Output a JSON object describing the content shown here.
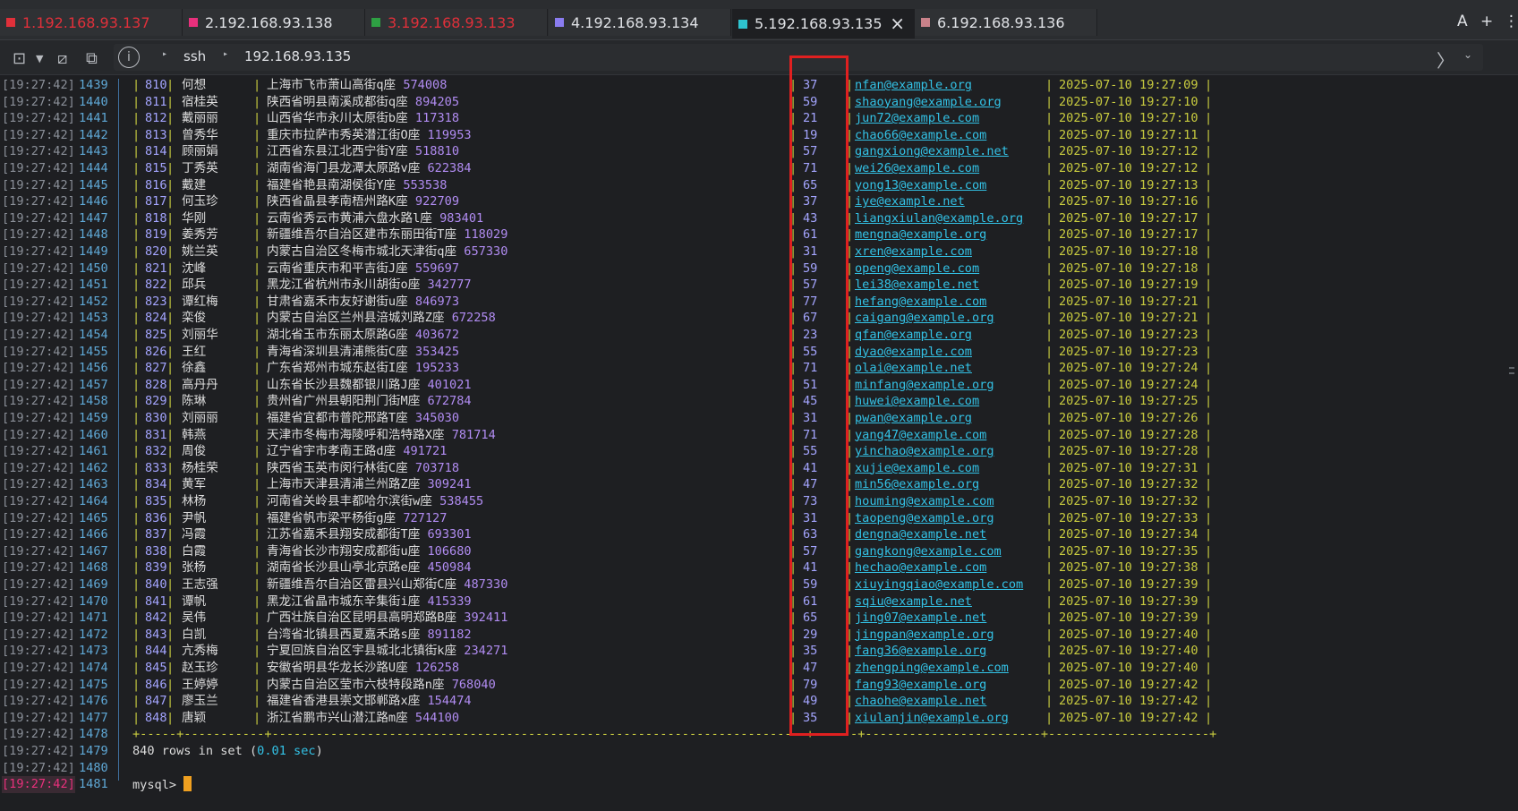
{
  "tabs": [
    {
      "label": "1.192.168.93.137",
      "color": "#e0303a",
      "text_color": "#e0303a"
    },
    {
      "label": "2.192.168.93.138",
      "color": "#e8307c",
      "text_color": "#dfe1e5"
    },
    {
      "label": "3.192.168.93.133",
      "color": "#2ea043",
      "text_color": "#e0303a"
    },
    {
      "label": "4.192.168.93.134",
      "color": "#8a7cf0",
      "text_color": "#dfe1e5"
    },
    {
      "label": "5.192.168.93.135",
      "color": "#2ec4d0",
      "text_color": "#dfe1e5",
      "active": true
    },
    {
      "label": "6.192.168.93.136",
      "color": "#c9828a",
      "text_color": "#dfe1e5"
    }
  ],
  "window_controls": {
    "font": "A",
    "add": "+",
    "more": "⋮"
  },
  "address": {
    "protocol": "ssh",
    "host": "192.168.93.135"
  },
  "rows": [
    {
      "ts": "[19:27:42]",
      "ln": "1439",
      "id": "810",
      "name": "何想",
      "addr": "上海市飞市萧山高街q座",
      "code": "574008",
      "age": "37",
      "email": "nfan@example.org",
      "date": "2025-07-10 19:27:09"
    },
    {
      "ts": "[19:27:42]",
      "ln": "1440",
      "id": "811",
      "name": "宿桂英",
      "addr": "陕西省明县南溪成都街q座",
      "code": "894205",
      "age": "59",
      "email": "shaoyang@example.org",
      "date": "2025-07-10 19:27:10"
    },
    {
      "ts": "[19:27:42]",
      "ln": "1441",
      "id": "812",
      "name": "戴丽丽",
      "addr": "山西省华市永川太原街b座",
      "code": "117318",
      "age": "21",
      "email": "jun72@example.com",
      "date": "2025-07-10 19:27:10"
    },
    {
      "ts": "[19:27:42]",
      "ln": "1442",
      "id": "813",
      "name": "曾秀华",
      "addr": "重庆市拉萨市秀英潜江街O座",
      "code": "119953",
      "age": "19",
      "email": "chao66@example.com",
      "date": "2025-07-10 19:27:11"
    },
    {
      "ts": "[19:27:42]",
      "ln": "1443",
      "id": "814",
      "name": "顾丽娟",
      "addr": "江西省东县江北西宁街Y座",
      "code": "518810",
      "age": "57",
      "email": "gangxiong@example.net",
      "date": "2025-07-10 19:27:12"
    },
    {
      "ts": "[19:27:42]",
      "ln": "1444",
      "id": "815",
      "name": "丁秀英",
      "addr": "湖南省海门县龙潭太原路v座",
      "code": "622384",
      "age": "71",
      "email": "wei26@example.com",
      "date": "2025-07-10 19:27:12"
    },
    {
      "ts": "[19:27:42]",
      "ln": "1445",
      "id": "816",
      "name": "戴建",
      "addr": "福建省艳县南湖侯街Y座",
      "code": "553538",
      "age": "65",
      "email": "yong13@example.com",
      "date": "2025-07-10 19:27:13"
    },
    {
      "ts": "[19:27:42]",
      "ln": "1446",
      "id": "817",
      "name": "何玉珍",
      "addr": "陕西省晶县孝南梧州路K座",
      "code": "922709",
      "age": "37",
      "email": "iye@example.net",
      "date": "2025-07-10 19:27:16"
    },
    {
      "ts": "[19:27:42]",
      "ln": "1447",
      "id": "818",
      "name": "华刚",
      "addr": "云南省秀云市黄浦六盘水路l座",
      "code": "983401",
      "age": "43",
      "email": "liangxiulan@example.org",
      "date": "2025-07-10 19:27:17"
    },
    {
      "ts": "[19:27:42]",
      "ln": "1448",
      "id": "819",
      "name": "姜秀芳",
      "addr": "新疆维吾尔自治区建市东丽田街T座",
      "code": "118029",
      "age": "61",
      "email": "mengna@example.org",
      "date": "2025-07-10 19:27:17"
    },
    {
      "ts": "[19:27:42]",
      "ln": "1449",
      "id": "820",
      "name": "姚兰英",
      "addr": "内蒙古自治区冬梅市城北天津街q座",
      "code": "657330",
      "age": "31",
      "email": "xren@example.com",
      "date": "2025-07-10 19:27:18"
    },
    {
      "ts": "[19:27:42]",
      "ln": "1450",
      "id": "821",
      "name": "沈峰",
      "addr": "云南省重庆市和平吉街J座",
      "code": "559697",
      "age": "59",
      "email": "openg@example.com",
      "date": "2025-07-10 19:27:18"
    },
    {
      "ts": "[19:27:42]",
      "ln": "1451",
      "id": "822",
      "name": "邱兵",
      "addr": "黑龙江省杭州市永川胡街o座",
      "code": "342777",
      "age": "57",
      "email": "lei38@example.net",
      "date": "2025-07-10 19:27:19"
    },
    {
      "ts": "[19:27:42]",
      "ln": "1452",
      "id": "823",
      "name": "谭红梅",
      "addr": "甘肃省嘉禾市友好谢街u座",
      "code": "846973",
      "age": "77",
      "email": "hefang@example.com",
      "date": "2025-07-10 19:27:21"
    },
    {
      "ts": "[19:27:42]",
      "ln": "1453",
      "id": "824",
      "name": "栾俊",
      "addr": "内蒙古自治区兰州县涪城刘路Z座",
      "code": "672258",
      "age": "67",
      "email": "caigang@example.org",
      "date": "2025-07-10 19:27:21"
    },
    {
      "ts": "[19:27:42]",
      "ln": "1454",
      "id": "825",
      "name": "刘丽华",
      "addr": "湖北省玉市东丽太原路G座",
      "code": "403672",
      "age": "23",
      "email": "qfan@example.org",
      "date": "2025-07-10 19:27:23"
    },
    {
      "ts": "[19:27:42]",
      "ln": "1455",
      "id": "826",
      "name": "王红",
      "addr": "青海省深圳县清浦熊街C座",
      "code": "353425",
      "age": "55",
      "email": "dyao@example.com",
      "date": "2025-07-10 19:27:23"
    },
    {
      "ts": "[19:27:42]",
      "ln": "1456",
      "id": "827",
      "name": "徐鑫",
      "addr": "广东省郑州市城东赵街I座",
      "code": "195233",
      "age": "71",
      "email": "olai@example.net",
      "date": "2025-07-10 19:27:24"
    },
    {
      "ts": "[19:27:42]",
      "ln": "1457",
      "id": "828",
      "name": "高丹丹",
      "addr": "山东省长沙县魏都银川路J座",
      "code": "401021",
      "age": "51",
      "email": "minfang@example.org",
      "date": "2025-07-10 19:27:24"
    },
    {
      "ts": "[19:27:42]",
      "ln": "1458",
      "id": "829",
      "name": "陈琳",
      "addr": "贵州省广州县朝阳荆门街M座",
      "code": "672784",
      "age": "45",
      "email": "huwei@example.com",
      "date": "2025-07-10 19:27:25"
    },
    {
      "ts": "[19:27:42]",
      "ln": "1459",
      "id": "830",
      "name": "刘丽丽",
      "addr": "福建省宜都市普陀邢路T座",
      "code": "345030",
      "age": "31",
      "email": "pwan@example.org",
      "date": "2025-07-10 19:27:26"
    },
    {
      "ts": "[19:27:42]",
      "ln": "1460",
      "id": "831",
      "name": "韩燕",
      "addr": "天津市冬梅市海陵呼和浩特路X座",
      "code": "781714",
      "age": "71",
      "email": "yang47@example.com",
      "date": "2025-07-10 19:27:28"
    },
    {
      "ts": "[19:27:42]",
      "ln": "1461",
      "id": "832",
      "name": "周俊",
      "addr": "辽宁省宇市孝南王路d座",
      "code": "491721",
      "age": "55",
      "email": "yinchao@example.org",
      "date": "2025-07-10 19:27:28"
    },
    {
      "ts": "[19:27:42]",
      "ln": "1462",
      "id": "833",
      "name": "杨桂荣",
      "addr": "陕西省玉英市闵行林街C座",
      "code": "703718",
      "age": "41",
      "email": "xujie@example.com",
      "date": "2025-07-10 19:27:31"
    },
    {
      "ts": "[19:27:42]",
      "ln": "1463",
      "id": "834",
      "name": "黄军",
      "addr": "上海市天津县清浦兰州路Z座",
      "code": "309241",
      "age": "47",
      "email": "min56@example.org",
      "date": "2025-07-10 19:27:32"
    },
    {
      "ts": "[19:27:42]",
      "ln": "1464",
      "id": "835",
      "name": "林杨",
      "addr": "河南省关岭县丰都哈尔滨街w座",
      "code": "538455",
      "age": "73",
      "email": "houming@example.com",
      "date": "2025-07-10 19:27:32"
    },
    {
      "ts": "[19:27:42]",
      "ln": "1465",
      "id": "836",
      "name": "尹帆",
      "addr": "福建省帆市梁平杨街g座",
      "code": "727127",
      "age": "31",
      "email": "taopeng@example.org",
      "date": "2025-07-10 19:27:33"
    },
    {
      "ts": "[19:27:42]",
      "ln": "1466",
      "id": "837",
      "name": "冯霞",
      "addr": "江苏省嘉禾县翔安成都街T座",
      "code": "693301",
      "age": "63",
      "email": "dengna@example.net",
      "date": "2025-07-10 19:27:34"
    },
    {
      "ts": "[19:27:42]",
      "ln": "1467",
      "id": "838",
      "name": "白霞",
      "addr": "青海省长沙市翔安成都街u座",
      "code": "106680",
      "age": "57",
      "email": "gangkong@example.com",
      "date": "2025-07-10 19:27:35"
    },
    {
      "ts": "[19:27:42]",
      "ln": "1468",
      "id": "839",
      "name": "张杨",
      "addr": "湖南省长沙县山亭北京路e座",
      "code": "450984",
      "age": "41",
      "email": "hechao@example.com",
      "date": "2025-07-10 19:27:38"
    },
    {
      "ts": "[19:27:42]",
      "ln": "1469",
      "id": "840",
      "name": "王志强",
      "addr": "新疆维吾尔自治区雷县兴山郑街C座",
      "code": "487330",
      "age": "59",
      "email": "xiuyingqiao@example.com",
      "date": "2025-07-10 19:27:39"
    },
    {
      "ts": "[19:27:42]",
      "ln": "1470",
      "id": "841",
      "name": "谭帆",
      "addr": "黑龙江省晶市城东辛集街i座",
      "code": "415339",
      "age": "61",
      "email": "sqiu@example.net",
      "date": "2025-07-10 19:27:39"
    },
    {
      "ts": "[19:27:42]",
      "ln": "1471",
      "id": "842",
      "name": "吴伟",
      "addr": "广西壮族自治区昆明县高明郑路B座",
      "code": "392411",
      "age": "65",
      "email": "jing07@example.net",
      "date": "2025-07-10 19:27:39"
    },
    {
      "ts": "[19:27:42]",
      "ln": "1472",
      "id": "843",
      "name": "白凯",
      "addr": "台湾省北镇县西夏嘉禾路s座",
      "code": "891182",
      "age": "29",
      "email": "jingpan@example.org",
      "date": "2025-07-10 19:27:40"
    },
    {
      "ts": "[19:27:42]",
      "ln": "1473",
      "id": "844",
      "name": "亢秀梅",
      "addr": "宁夏回族自治区宇县城北北镇街k座",
      "code": "234271",
      "age": "35",
      "email": "fang36@example.org",
      "date": "2025-07-10 19:27:40"
    },
    {
      "ts": "[19:27:42]",
      "ln": "1474",
      "id": "845",
      "name": "赵玉珍",
      "addr": "安徽省明县华龙长沙路U座",
      "code": "126258",
      "age": "47",
      "email": "zhengping@example.com",
      "date": "2025-07-10 19:27:40"
    },
    {
      "ts": "[19:27:42]",
      "ln": "1475",
      "id": "846",
      "name": "王婷婷",
      "addr": "内蒙古自治区莹市六枝特段路n座",
      "code": "768040",
      "age": "79",
      "email": "fang93@example.org",
      "date": "2025-07-10 19:27:42"
    },
    {
      "ts": "[19:27:42]",
      "ln": "1476",
      "id": "847",
      "name": "廖玉兰",
      "addr": "福建省香港县崇文邯郸路x座",
      "code": "154474",
      "age": "49",
      "email": "chaohe@example.net",
      "date": "2025-07-10 19:27:42"
    },
    {
      "ts": "[19:27:42]",
      "ln": "1477",
      "id": "848",
      "name": "唐颖",
      "addr": "浙江省鹏市兴山潜江路m座",
      "code": "544100",
      "age": "35",
      "email": "xiulanjin@example.org",
      "date": "2025-07-10 19:27:42"
    }
  ],
  "footer": {
    "border": "+-----+-----------+-------------------------------------------------------------------------+------+------------------------+----------------------+",
    "border_ts": "[19:27:42]",
    "border_ln": "1478",
    "rows_ts": "[19:27:42]",
    "rows_ln": "1479",
    "rows_prefix": "840 rows in set (",
    "rows_time": "0.01 sec",
    "rows_suffix": ")",
    "blank_ts": "[19:27:42]",
    "blank_ln": "1480",
    "prompt_ts": "[19:27:42]",
    "prompt_ln": "1481",
    "prompt": "mysql>"
  },
  "colors": {
    "highlight": "#e02020",
    "cursor": "#f0a020"
  }
}
